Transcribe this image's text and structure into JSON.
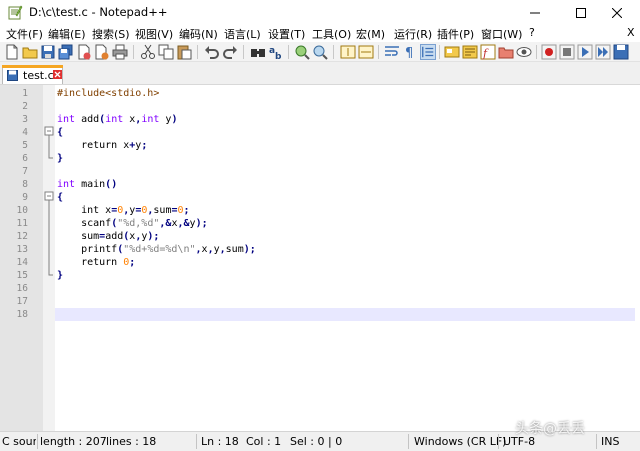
{
  "window": {
    "title": "D:\\c\\test.c - Notepad++",
    "app_icon": "notepad-plus-plus-icon"
  },
  "menu": [
    {
      "label": "文件(F)"
    },
    {
      "label": "编辑(E)"
    },
    {
      "label": "搜索(S)"
    },
    {
      "label": "视图(V)"
    },
    {
      "label": "编码(N)"
    },
    {
      "label": "语言(L)"
    },
    {
      "label": "设置(T)"
    },
    {
      "label": "工具(O)"
    },
    {
      "label": "宏(M)"
    },
    {
      "label": "运行(R)"
    },
    {
      "label": "插件(P)"
    },
    {
      "label": "窗口(W)"
    },
    {
      "label": "?"
    }
  ],
  "menu_close": "X",
  "toolbar_icons": [
    "new-file-icon",
    "open-file-icon",
    "save-icon",
    "save-all-icon",
    "close-icon",
    "close-all-icon",
    "print-icon",
    "cut-icon",
    "copy-icon",
    "paste-icon",
    "undo-icon",
    "redo-icon",
    "find-icon",
    "replace-icon",
    "zoom-in-icon",
    "zoom-out-icon",
    "sync-vertical-icon",
    "sync-horizontal-icon",
    "word-wrap-icon",
    "show-all-chars-icon",
    "indent-guide-icon",
    "user-language-icon",
    "doc-map-icon",
    "function-list-icon",
    "folder-workspace-icon",
    "monitoring-icon",
    "record-macro-icon",
    "stop-record-icon",
    "play-macro-icon",
    "run-macro-multiple-icon",
    "save-macro-icon"
  ],
  "tab": {
    "label": "test.c",
    "icon": "file-saved-icon",
    "close_icon": "tab-close-icon"
  },
  "editor": {
    "current_line": 18,
    "lines": [
      {
        "n": "1",
        "code": "#include<stdio.h>"
      },
      {
        "n": "2",
        "code": ""
      },
      {
        "n": "3",
        "code": "int add(int x,int y)"
      },
      {
        "n": "4",
        "code": "{"
      },
      {
        "n": "5",
        "code": "    return x+y;"
      },
      {
        "n": "6",
        "code": "}"
      },
      {
        "n": "7",
        "code": ""
      },
      {
        "n": "8",
        "code": "int main()"
      },
      {
        "n": "9",
        "code": "{"
      },
      {
        "n": "10",
        "code": "    int x=0,y=0,sum=0;"
      },
      {
        "n": "11",
        "code": "    scanf(\"%d,%d\",&x,&y);"
      },
      {
        "n": "12",
        "code": "    sum=add(x,y);"
      },
      {
        "n": "13",
        "code": "    printf(\"%d+%d=%d\\n\",x,y,sum);"
      },
      {
        "n": "14",
        "code": "    return 0;"
      },
      {
        "n": "15",
        "code": "}"
      },
      {
        "n": "16",
        "code": ""
      },
      {
        "n": "17",
        "code": ""
      },
      {
        "n": "18",
        "code": ""
      }
    ]
  },
  "status": {
    "lang": "C sour",
    "length": "length : 207",
    "lines": "lines : 18",
    "ln": "Ln : 18",
    "col": "Col : 1",
    "sel": "Sel : 0 | 0",
    "eol": "Windows (CR LF)",
    "encoding": "UTF-8",
    "mode": "INS"
  },
  "watermark": "头条@丢丢",
  "colors": {
    "keyword": "#0000ff",
    "type": "#8000ff",
    "preprocessor": "#804000",
    "number": "#ff8000",
    "string": "#808080",
    "current_line": "#e8e8ff",
    "tab_accent": "#f5a623"
  }
}
